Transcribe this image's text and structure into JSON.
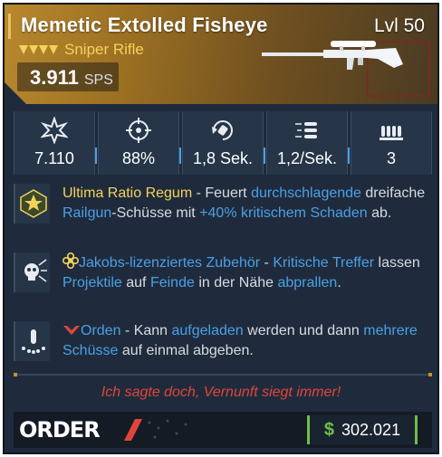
{
  "weapon": {
    "name": "Memetic Extolled Fisheye",
    "level": "Lvl 50",
    "type": "Sniper Rifle",
    "sps_value": "3.911",
    "sps_unit": "SPS"
  },
  "stats": [
    {
      "icon": "damage-burst-icon",
      "value": "7.110"
    },
    {
      "icon": "accuracy-crosshair-icon",
      "value": "88%"
    },
    {
      "icon": "reload-time-icon",
      "value": "1,8 Sek."
    },
    {
      "icon": "fire-rate-icon",
      "value": "1,2/Sek."
    },
    {
      "icon": "magazine-ammo-icon",
      "value": "3"
    }
  ],
  "perks": [
    {
      "icon": "star-badge-icon",
      "segments": [
        {
          "text": "Ultima Ratio Regum",
          "style": "yellow"
        },
        {
          "text": " - Feuert ",
          "style": "plain"
        },
        {
          "text": "durchschlagende",
          "style": "blue"
        },
        {
          "text": " dreifache ",
          "style": "plain"
        },
        {
          "text": "Railgun",
          "style": "blue"
        },
        {
          "text": "-Schüsse mit ",
          "style": "plain"
        },
        {
          "text": "+40% kritischem Schaden",
          "style": "blue"
        },
        {
          "text": " ab.",
          "style": "plain"
        }
      ]
    },
    {
      "icon": "skull-ricochet-icon",
      "glyph": "flower-glyph",
      "segments": [
        {
          "text": "Jakobs-lizenziertes Zubehör",
          "style": "blue"
        },
        {
          "text": " - ",
          "style": "plain"
        },
        {
          "text": "Kritische Treffer",
          "style": "blue"
        },
        {
          "text": " lassen ",
          "style": "plain"
        },
        {
          "text": "Projektile",
          "style": "blue"
        },
        {
          "text": " auf ",
          "style": "plain"
        },
        {
          "text": "Feinde",
          "style": "blue"
        },
        {
          "text": " in der Nähe ",
          "style": "plain"
        },
        {
          "text": "abprallen",
          "style": "blue"
        },
        {
          "text": ".",
          "style": "plain"
        }
      ]
    },
    {
      "icon": "charged-bullet-icon",
      "glyph": "chevron-glyph",
      "segments": [
        {
          "text": "Orden",
          "style": "blue"
        },
        {
          "text": " - Kann ",
          "style": "plain"
        },
        {
          "text": "aufgeladen",
          "style": "blue"
        },
        {
          "text": " werden und dann ",
          "style": "plain"
        },
        {
          "text": "mehrere Schüsse",
          "style": "blue"
        },
        {
          "text": " auf einmal abgeben.",
          "style": "plain"
        }
      ]
    }
  ],
  "flavor_text": "Ich sagte doch, Vernunft siegt immer!",
  "manufacturer": "ORDER",
  "price": {
    "currency_symbol": "$",
    "value": "302.021"
  },
  "colors": {
    "rarity_gold": "#b8882e",
    "highlight_yellow": "#f5d25a",
    "highlight_blue": "#4aa0e6",
    "flavor_red": "#e0453a",
    "price_green": "#6cc04a"
  }
}
